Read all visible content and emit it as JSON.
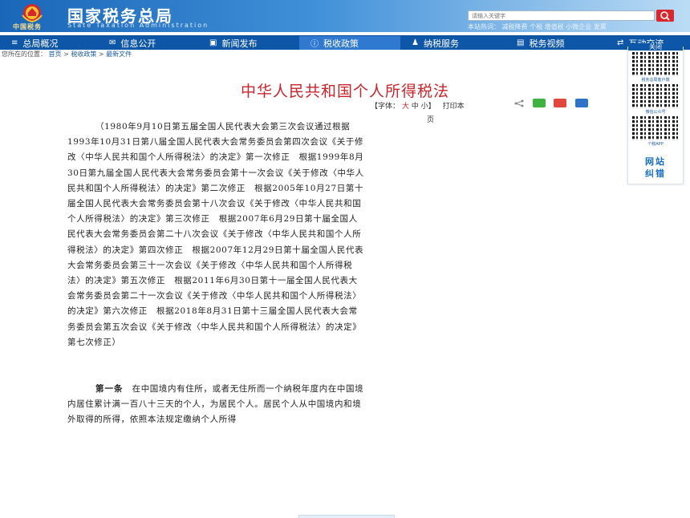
{
  "header": {
    "site_title": "国家税务总局",
    "site_subtitle": "State Taxation Administration",
    "emblem_text": "中国税务",
    "search_placeholder": "请输入关键字",
    "hot_words": "本站热词：  减税降费  个税  增值税  小微企业  发票"
  },
  "nav": {
    "items": [
      {
        "icon": "≡",
        "label": "总局概况"
      },
      {
        "icon": "✉",
        "label": "信息公开"
      },
      {
        "icon": "▣",
        "label": "新闻发布"
      },
      {
        "icon": "ⓘ",
        "label": "税收政策"
      },
      {
        "icon": "♟",
        "label": "纳税服务"
      },
      {
        "icon": "▤",
        "label": "税务视频"
      },
      {
        "icon": "⇄",
        "label": "互动交流"
      }
    ]
  },
  "breadcrumb": {
    "prefix": "您所在的位置：",
    "items": [
      "首页",
      "税收政策",
      "最新文件"
    ],
    "separator": ">"
  },
  "article": {
    "title": "中华人民共和国个人所得税法",
    "font_label": "【字体：",
    "font_large": "大",
    "font_medium": "中",
    "font_small": "小】",
    "print_label": "打印本",
    "print_tail": "页",
    "para1": "（1980年9月10日第五届全国人民代表大会第三次会议通过根据1993年10月31日第八届全国人民代表大会常务委员会第四次会议《关于修改〈中华人民共和国个人所得税法〉的决定》第一次修正　根据1999年8月30日第九届全国人民代表大会常务委员会第十一次会议《关于修改〈中华人民共和国个人所得税法〉的决定》第二次修正　根据2005年10月27日第十届全国人民代表大会常务委员会第十八次会议《关于修改〈中华人民共和国个人所得税法〉的决定》第三次修正　根据2007年6月29日第十届全国人民代表大会常务委员会第二十八次会议《关于修改〈中华人民共和国个人所得税法〉的决定》第四次修正　根据2007年12月29日第十届全国人民代表大会常务委员会第三十一次会议《关于修改〈中华人民共和国个人所得税法〉的决定》第五次修正　根据2011年6月30日第十一届全国人民代表大会常务委员会第二十一次会议《关于修改〈中华人民共和国个人所得税法〉的决定》第六次修正　根据2018年8月31日第十三届全国人民代表大会常务委员会第五次会议《关于修改〈中华人民共和国个人所得税法〉的决定》第七次修正）",
    "article_one_label": "第一条",
    "article_one_text": "　在中国境内有住所，或者无住所而一个纳税年度内在中国境内居住累计满一百八十三天的个人，为居民个人。居民个人从中国境内和境外取得的所得，依照本法规定缴纳个人所得"
  },
  "side_panel": {
    "head": "关闭",
    "qr_labels": [
      "税务总局客户端",
      "微信公众号",
      "个税APP"
    ],
    "report_line1": "网站",
    "report_line2": "纠错"
  },
  "colors": {
    "header_blue": "#1a66b8",
    "nav_blue": "#0e57a8",
    "title_red": "#c8242b",
    "link_blue": "#1a5ca8"
  }
}
